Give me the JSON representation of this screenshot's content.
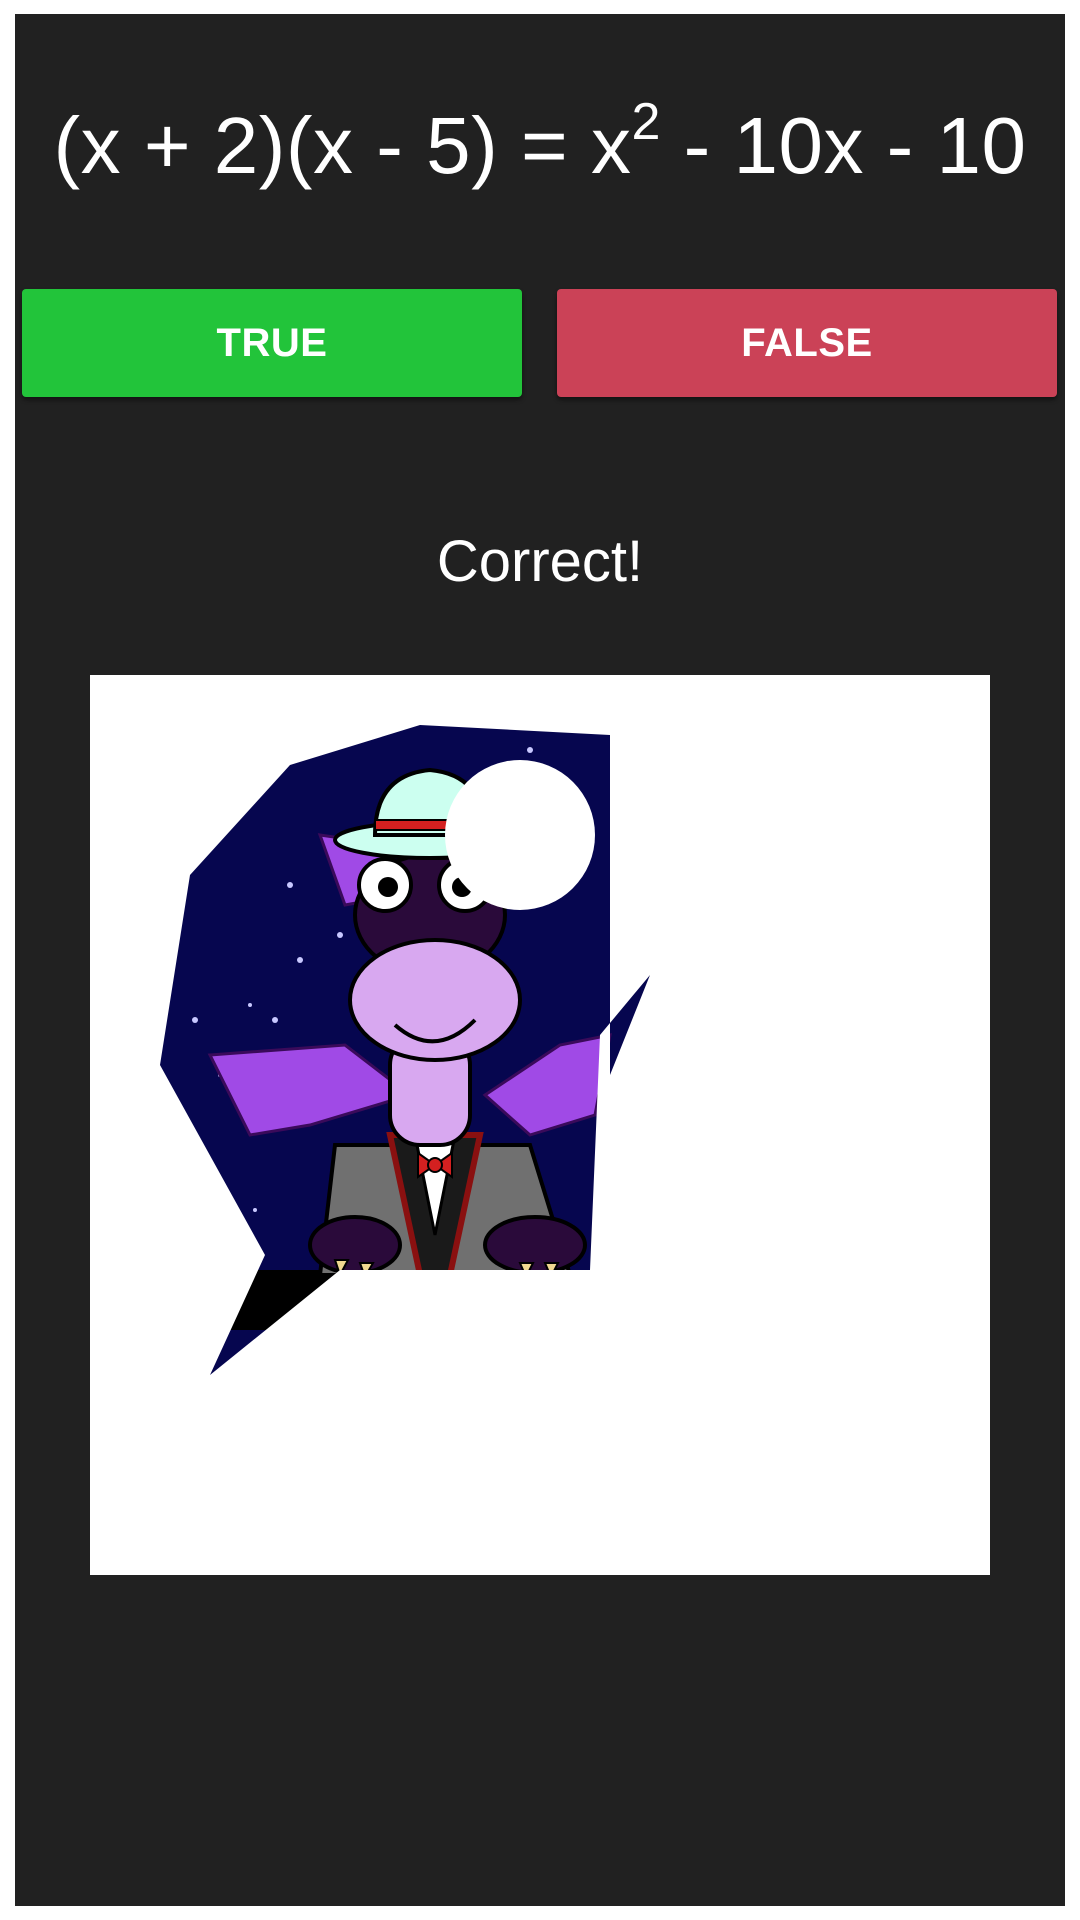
{
  "equation": {
    "lhs": "(x + 2)(x - 5) = x",
    "exponent": "2",
    "rhs": " - 10x - 10"
  },
  "buttons": {
    "true_label": "TRUE",
    "false_label": "FALSE"
  },
  "feedback": "Correct!",
  "colors": {
    "background": "#212121",
    "true_button": "#22c43a",
    "false_button": "#cb4257",
    "night_sky": "#06064f"
  },
  "picture": {
    "icon": "dragon-in-bowler-hat-icon"
  }
}
